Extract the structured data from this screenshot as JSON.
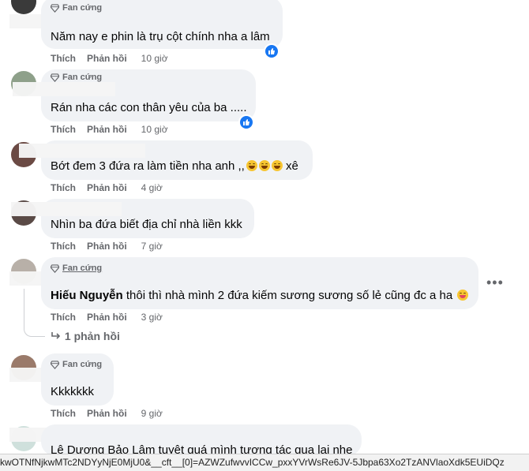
{
  "badge_label": "Fan cứng",
  "action_like": "Thích",
  "action_reply": "Phản hồi",
  "colors": {
    "bubble": "#f0f2f5",
    "like_blue": "#1877f2",
    "meta": "#65676b"
  },
  "comments": [
    {
      "text": "Năm nay e phin là trụ cột chính nha a lâm",
      "time": "10 giờ",
      "liked": true
    },
    {
      "text": "Rán nha các con thân yêu của ba .....",
      "time": "10 giờ",
      "liked": true
    },
    {
      "text": "Bớt đem 3 đứa ra làm tiền nha anh ,,",
      "text_after": "xê",
      "time": "4 giờ"
    },
    {
      "text": "Nhìn ba đứa biết địa chỉ nhà liền kkk",
      "time": "7 giờ"
    },
    {
      "mention": "Hiếu Nguyễn",
      "text": "thôi thì nhà mình 2 đứa kiếm sương sương số lẻ cũng đc a ha",
      "time": "3 giờ",
      "replies": "1 phản hồi",
      "more": "•••"
    },
    {
      "text": "Kkkkkkk",
      "time": "9 giờ"
    },
    {
      "text": "Lê Dương Bảo Lâm tuyệt quá mình tương tác qua lại nhe"
    }
  ],
  "status_url": "kwOTNfNjkwMTc2NDYyNjE0MjU0&__cft__[0]=AZWZufwvvICCw_pxxYVrWsRe6JV-5Jbpa63Xo2TzANVlaoXdk5EUiDQz"
}
